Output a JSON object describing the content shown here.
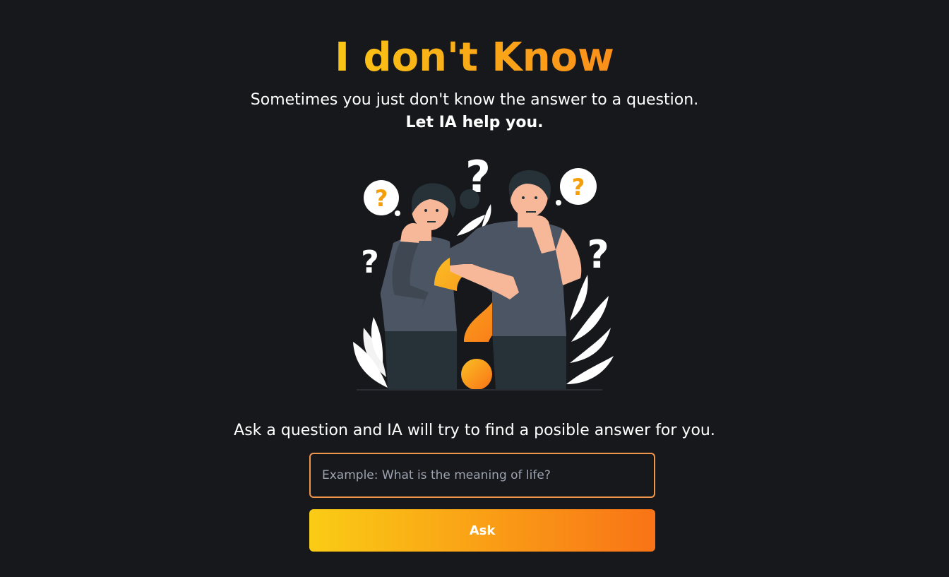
{
  "header": {
    "title": "I don't Know",
    "subtitle": "Sometimes you just don't know the answer to a question.",
    "subtitle_strong": "Let IA help you."
  },
  "illustration": {
    "icon": "two-people-thinking-with-question-marks",
    "colors": {
      "accent": "#f59e0b",
      "shirt": "#4b5563",
      "skin": "#f7b89a",
      "hair": "#263238",
      "leaves": "#ffffff"
    }
  },
  "form": {
    "prompt": "Ask a question and IA will try to find a posible answer for you.",
    "input_value": "",
    "input_placeholder": "Example: What is the meaning of life?",
    "button_label": "Ask"
  },
  "theme": {
    "background": "#17181c",
    "gradient_start": "#facc15",
    "gradient_end": "#f97316",
    "input_border": "#f0964a"
  }
}
